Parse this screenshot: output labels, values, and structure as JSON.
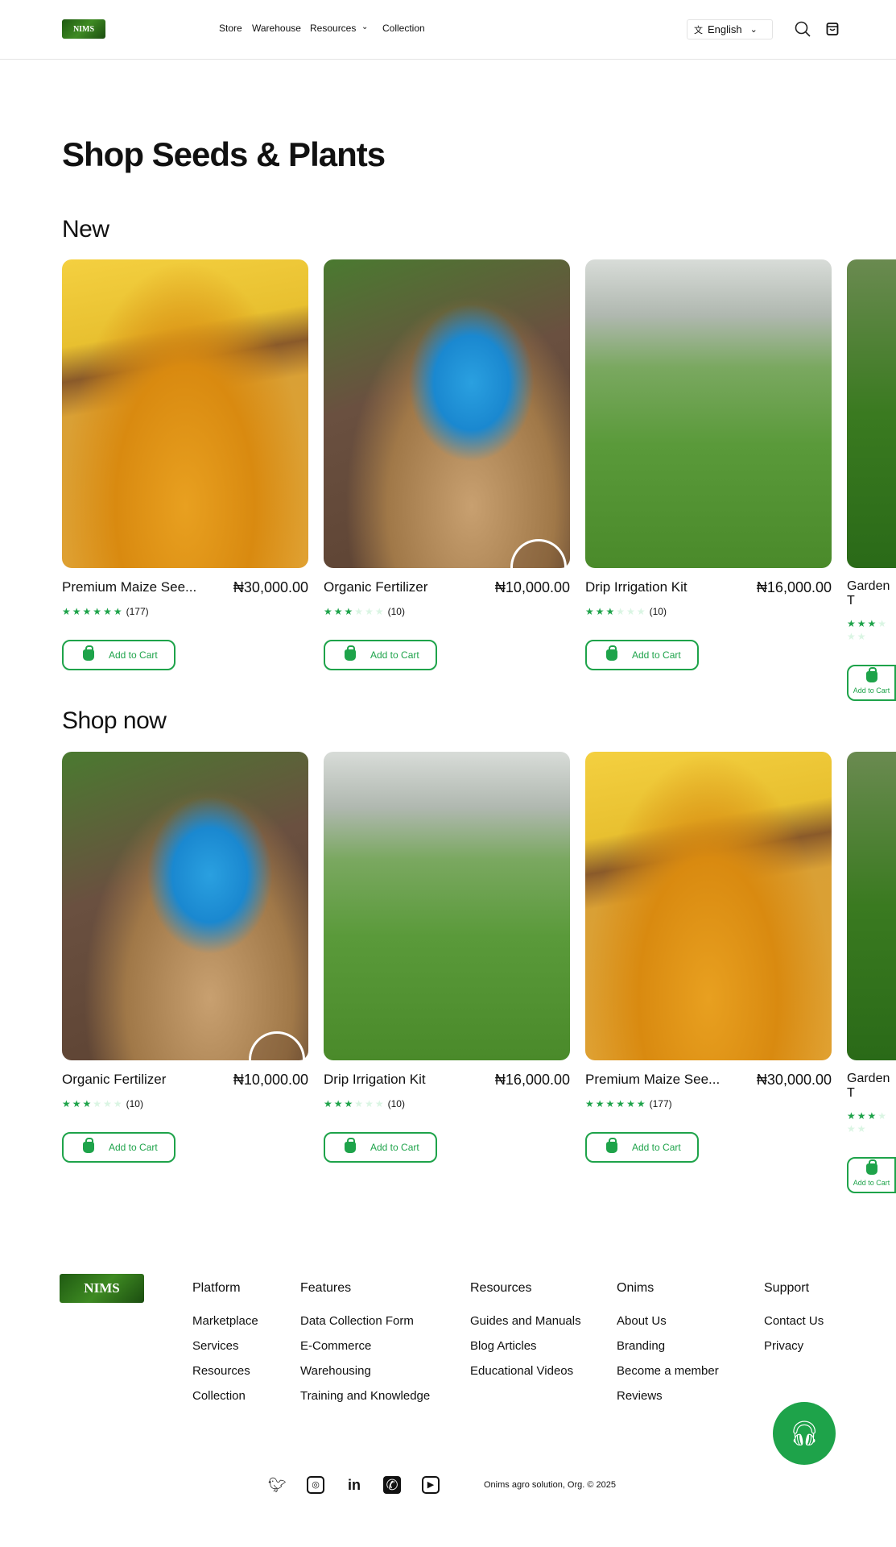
{
  "header": {
    "logo_text": "NIMS",
    "nav": [
      "Store",
      "Warehouse",
      "Resources",
      "Collection"
    ],
    "language": "English"
  },
  "page_title": "Shop Seeds & Plants",
  "sections": [
    {
      "title": "New",
      "products": [
        {
          "name": "Premium  Maize See...",
          "price": "₦30,000.00",
          "rating": 6,
          "max": 6,
          "count": "(177)",
          "image": "maize",
          "button": "Add to Cart"
        },
        {
          "name": "Organic Fertilizer",
          "price": "₦10,000.00",
          "rating": 3,
          "max": 6,
          "count": "(10)",
          "image": "fert",
          "button": "Add to Cart"
        },
        {
          "name": "Drip Irrigation Kit",
          "price": "₦16,000.00",
          "rating": 3,
          "max": 6,
          "count": "(10)",
          "image": "irr",
          "button": "Add to Cart"
        },
        {
          "name": "Garden T",
          "price": "",
          "rating": 3,
          "max": 6,
          "count": "",
          "image": "garden",
          "button": "Add to Cart"
        }
      ]
    },
    {
      "title": "Shop now",
      "products": [
        {
          "name": "Organic Fertilizer",
          "price": "₦10,000.00",
          "rating": 3,
          "max": 6,
          "count": "(10)",
          "image": "fert",
          "button": "Add to Cart"
        },
        {
          "name": "Drip Irrigation Kit",
          "price": "₦16,000.00",
          "rating": 3,
          "max": 6,
          "count": "(10)",
          "image": "irr",
          "button": "Add to Cart"
        },
        {
          "name": "Premium  Maize See...",
          "price": "₦30,000.00",
          "rating": 6,
          "max": 6,
          "count": "(177)",
          "image": "maize",
          "button": "Add to Cart"
        },
        {
          "name": "Garden T",
          "price": "",
          "rating": 3,
          "max": 6,
          "count": "",
          "image": "garden",
          "button": "Add to Cart"
        }
      ]
    }
  ],
  "footer": {
    "columns": [
      {
        "title": "Platform",
        "links": [
          "Marketplace",
          "Services",
          "Resources",
          "Collection"
        ]
      },
      {
        "title": "Features",
        "links": [
          "Data Collection Form",
          "E-Commerce",
          "Warehousing",
          "Training and Knowledge"
        ]
      },
      {
        "title": "Resources",
        "links": [
          "Guides and Manuals",
          "Blog Articles",
          "Educational Videos"
        ]
      },
      {
        "title": "Onims",
        "links": [
          "About Us",
          "Branding",
          "Become a member",
          "Reviews"
        ]
      },
      {
        "title": "Support",
        "links": [
          "Contact Us",
          "Privacy"
        ]
      }
    ],
    "socials": [
      "twitter-icon",
      "instagram-icon",
      "linkedin-icon",
      "whatsapp-icon",
      "youtube-icon"
    ],
    "copyright": "Onims agro solution, Org. © 2025"
  },
  "colors": {
    "accent": "#1ea34a"
  }
}
